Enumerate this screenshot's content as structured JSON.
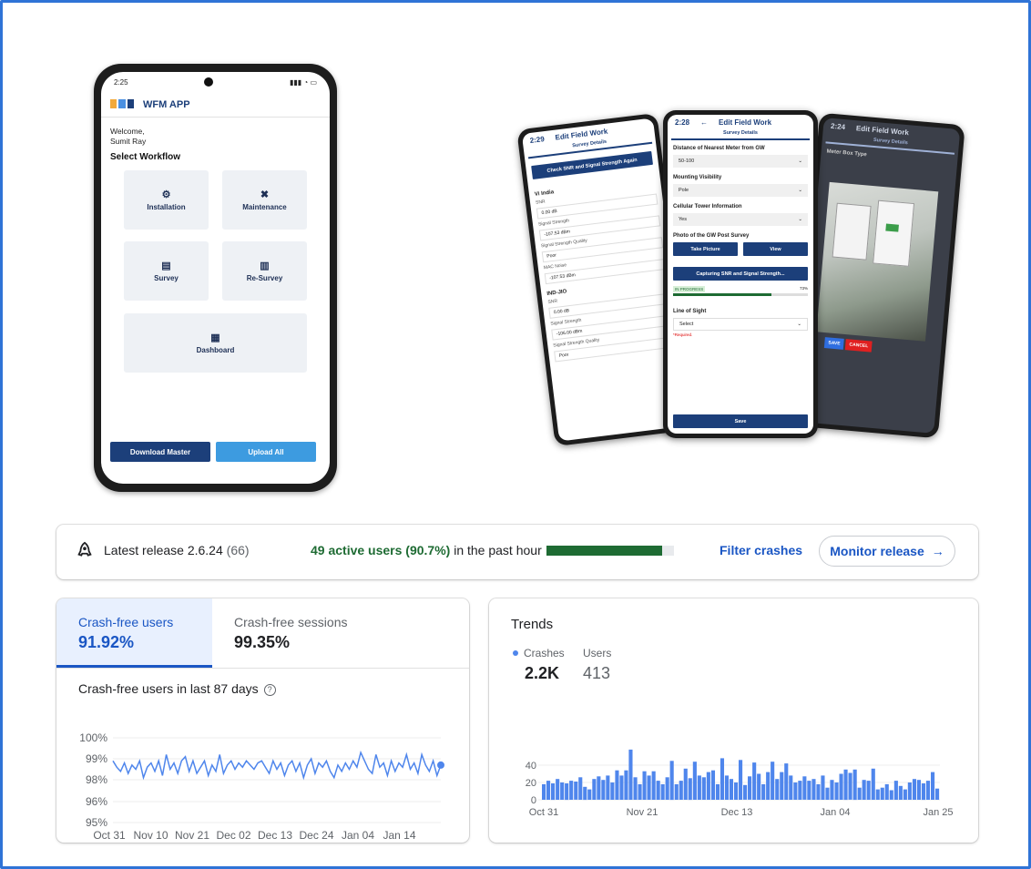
{
  "phone": {
    "time": "2:25",
    "app_title": "WFM APP",
    "welcome": "Welcome,",
    "user": "Sumit Ray",
    "select_workflow": "Select Workflow",
    "tiles": [
      "Installation",
      "Maintenance",
      "Survey",
      "Re-Survey",
      "Dashboard"
    ],
    "download_master": "Download Master",
    "upload_all": "Upload All"
  },
  "trio": {
    "left": {
      "time": "2:29",
      "title": "Edit Field Work",
      "tab": "Survey Details",
      "check_btn": "Check SNR and Signal Strength Again",
      "op1": "Vi India",
      "rows1": [
        [
          "SNR",
          "0.00 dB"
        ],
        [
          "Signal Strength",
          "-107.53 dBm"
        ],
        [
          "Signal Strength Quality",
          "Poor"
        ],
        [
          "MAC Noise",
          "-107.53 dBm"
        ]
      ],
      "op2": "IND-JIO",
      "rows2": [
        [
          "SNR",
          "0.00 dB"
        ],
        [
          "Signal Strength",
          "-106.00 dBm"
        ],
        [
          "Signal Strength Quality",
          "Poor"
        ]
      ]
    },
    "center": {
      "time": "2:28",
      "title": "Edit Field Work",
      "tab": "Survey Details",
      "q1": "Distance of Nearest Meter from GW",
      "a1": "50-100",
      "q2": "Mounting Visibility",
      "a2": "Pole",
      "q3": "Cellular Tower Information",
      "a3": "Yes",
      "q4": "Photo of the GW Post Survey",
      "take_picture": "Take Picture",
      "view": "View",
      "capturing": "Capturing SNR and Signal Strength...",
      "progress_label": "IN PROGRESS",
      "progress_value": "73%",
      "progress": 0.73,
      "q5": "Line of Sight",
      "a5": "Select",
      "required": "*Required.",
      "save": "Save"
    },
    "right": {
      "time": "2:24",
      "title": "Edit Field Work",
      "tab": "Survey Details",
      "field_label": "Meter Box Type",
      "save": "SAVE",
      "cancel": "CANCEL"
    }
  },
  "release": {
    "label": "Latest release 2.6.24",
    "count": "(66)",
    "active_bold": "49 active users (90.7%)",
    "active_rest": " in the past hour",
    "active_fraction": 0.907,
    "filter": "Filter crashes",
    "monitor": "Monitor release",
    "arrow": "→"
  },
  "crash": {
    "tab1_label": "Crash-free users",
    "tab1_value": "91.92%",
    "tab2_label": "Crash-free sessions",
    "tab2_value": "99.35%",
    "chart_title": "Crash-free users in last 87 days",
    "help": "?"
  },
  "trends": {
    "title": "Trends",
    "legend1": "Crashes",
    "legend2": "Users",
    "value1": "2.2K",
    "value2": "413"
  },
  "colors": {
    "accent": "#1a56c4",
    "series": "#4f86ec",
    "progress": "#1e6b33",
    "brand": "#1c3f7a"
  },
  "chart_data": [
    {
      "type": "line",
      "title": "Crash-free users in last 87 days",
      "ylim": [
        95,
        100
      ],
      "y_ticks": [
        "95%",
        "96%",
        "98%",
        "99%",
        "100%"
      ],
      "x_ticks": [
        "Oct 31",
        "Nov 10",
        "Nov 21",
        "Dec 02",
        "Dec 13",
        "Dec 24",
        "Jan 04",
        "Jan 14"
      ],
      "series": [
        {
          "values": [
            98.9,
            98.6,
            98.4,
            98.8,
            98.3,
            98.7,
            98.5,
            98.9,
            98.1,
            98.6,
            98.8,
            98.4,
            98.9,
            98.2,
            99.2,
            98.5,
            98.8,
            98.3,
            98.9,
            99.1,
            98.4,
            98.9,
            98.3,
            98.6,
            98.9,
            98.2,
            98.7,
            98.4,
            99.2,
            98.3,
            98.7,
            98.9,
            98.5,
            98.8,
            98.6,
            98.9,
            98.7,
            98.5,
            98.8,
            98.9,
            98.6,
            98.3,
            98.9,
            98.5,
            98.8,
            98.2,
            98.7,
            98.9,
            98.4,
            98.8,
            98.1,
            98.7,
            99.0,
            98.3,
            98.8,
            98.6,
            98.9,
            98.4,
            98.1,
            98.7,
            98.4,
            98.8,
            98.5,
            98.9,
            98.6,
            99.3,
            98.9,
            98.5,
            98.3,
            99.2,
            98.6,
            98.8,
            98.2,
            98.9,
            98.4,
            98.8,
            98.6,
            99.2,
            98.5,
            98.8,
            98.3,
            99.2,
            98.7,
            98.4,
            98.9,
            98.2,
            98.7
          ]
        }
      ]
    },
    {
      "type": "bar",
      "title": "Trends",
      "ylim": [
        0,
        60
      ],
      "y_ticks": [
        "0",
        "20",
        "40"
      ],
      "x_ticks": [
        "Oct 31",
        "Nov 21",
        "Dec 13",
        "Jan 04",
        "Jan 25"
      ],
      "series": [
        {
          "name": "Crashes",
          "values": [
            18,
            22,
            19,
            24,
            20,
            19,
            22,
            21,
            26,
            15,
            12,
            24,
            27,
            23,
            28,
            20,
            34,
            28,
            34,
            58,
            26,
            18,
            33,
            28,
            33,
            22,
            18,
            26,
            45,
            18,
            22,
            36,
            25,
            44,
            28,
            26,
            32,
            34,
            18,
            48,
            28,
            24,
            20,
            46,
            17,
            27,
            43,
            30,
            18,
            32,
            44,
            24,
            32,
            42,
            28,
            20,
            22,
            27,
            22,
            24,
            18,
            28,
            14,
            23,
            20,
            30,
            35,
            31,
            35,
            14,
            23,
            22,
            36,
            12,
            14,
            18,
            11,
            22,
            16,
            12,
            20,
            24,
            23,
            19,
            22,
            32,
            13
          ]
        }
      ]
    }
  ]
}
